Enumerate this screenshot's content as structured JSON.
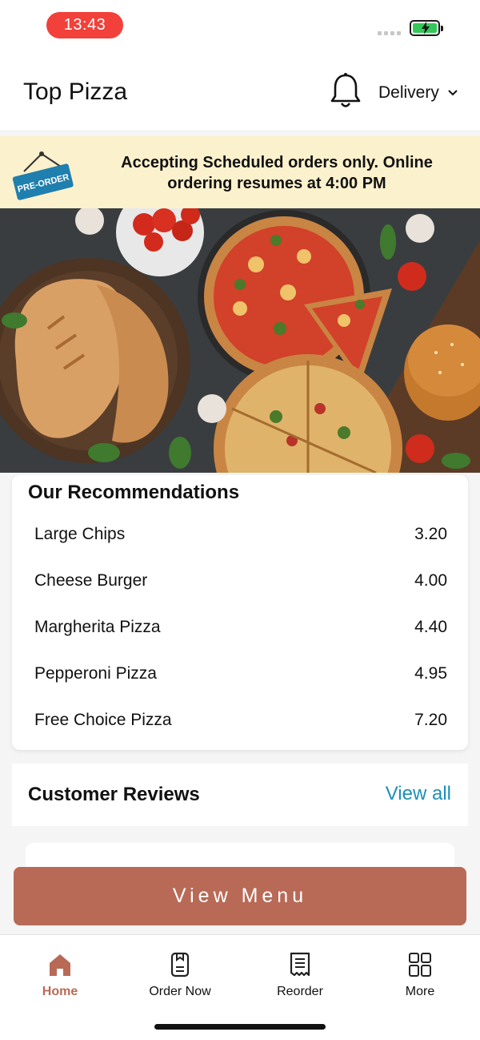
{
  "status_bar": {
    "time": "13:43"
  },
  "header": {
    "title": "Top Pizza",
    "mode_label": "Delivery",
    "icons": [
      "bell-icon",
      "chevron-down-icon"
    ]
  },
  "banner": {
    "badge_text": "PRE-ORDER",
    "message": "Accepting Scheduled orders only. Online ordering resumes at 4:00 PM"
  },
  "recommendations": {
    "title": "Our Recommendations",
    "items": [
      {
        "name": "Large Chips",
        "price": "3.20"
      },
      {
        "name": "Cheese Burger",
        "price": "4.00"
      },
      {
        "name": "Margherita Pizza",
        "price": "4.40"
      },
      {
        "name": "Pepperoni Pizza",
        "price": "4.95"
      },
      {
        "name": "Free Choice Pizza",
        "price": "7.20"
      }
    ]
  },
  "reviews": {
    "title": "Customer Reviews",
    "view_all_label": "View all"
  },
  "cta": {
    "label": "View Menu"
  },
  "tabs": [
    {
      "label": "Home",
      "icon": "home-icon",
      "active": true
    },
    {
      "label": "Order Now",
      "icon": "order-icon",
      "active": false
    },
    {
      "label": "Reorder",
      "icon": "receipt-icon",
      "active": false
    },
    {
      "label": "More",
      "icon": "grid-icon",
      "active": false
    }
  ],
  "colors": {
    "accent": "#b86a57",
    "link": "#1c8fb8",
    "banner_bg": "#fcf1cd",
    "time_pill": "#f2403a"
  }
}
